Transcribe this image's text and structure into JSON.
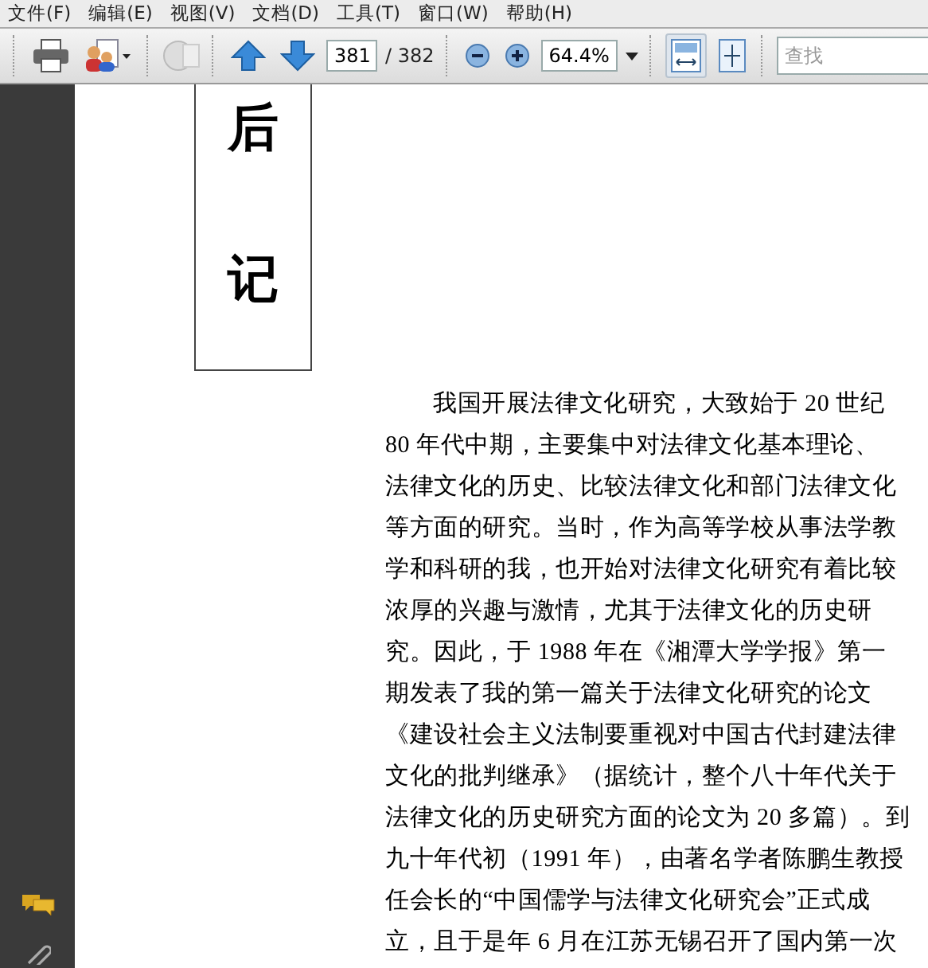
{
  "menu": [
    "文件(F)",
    "编辑(E)",
    "视图(V)",
    "文档(D)",
    "工具(T)",
    "窗口(W)",
    "帮助(H)"
  ],
  "toolbar": {
    "page_number": "381",
    "page_total": "/ 382",
    "zoom": "64.4%",
    "fit_width_selected": true,
    "search": {
      "placeholder": "查找"
    }
  },
  "document": {
    "heading": [
      "后",
      "记"
    ],
    "lines": [
      {
        "text": "我国开展法律文化研究，大致始于 20 世纪",
        "indent": true
      },
      {
        "text": "80 年代中期，主要集中对法律文化基本理论、",
        "indent": false
      },
      {
        "text": "法律文化的历史、比较法律文化和部门法律文化",
        "indent": false
      },
      {
        "text": "等方面的研究。当时，作为高等学校从事法学教",
        "indent": false
      },
      {
        "text": "学和科研的我，也开始对法律文化研究有着比较",
        "indent": false
      },
      {
        "text": "浓厚的兴趣与激情，尤其于法律文化的历史研",
        "indent": false
      },
      {
        "text": "究。因此，于 1988 年在《湘潭大学学报》第一",
        "indent": false
      },
      {
        "text": "期发表了我的第一篇关于法律文化研究的论文",
        "indent": false
      },
      {
        "text": "《建设社会主义法制要重视对中国古代封建法律",
        "indent": false
      },
      {
        "text": "文化的批判继承》（据统计，整个八十年代关于",
        "indent": false
      },
      {
        "text": "法律文化的历史研究方面的论文为 20 多篇）。到",
        "indent": false
      },
      {
        "text": "九十年代初（1991 年），由著名学者陈鹏生教授",
        "indent": false
      },
      {
        "text": "任会长的“中国儒学与法律文化研究会”正式成",
        "indent": false
      },
      {
        "text": "立，且于是年 6 月在江苏无锡召开了国内第一次",
        "indent": false
      }
    ]
  }
}
